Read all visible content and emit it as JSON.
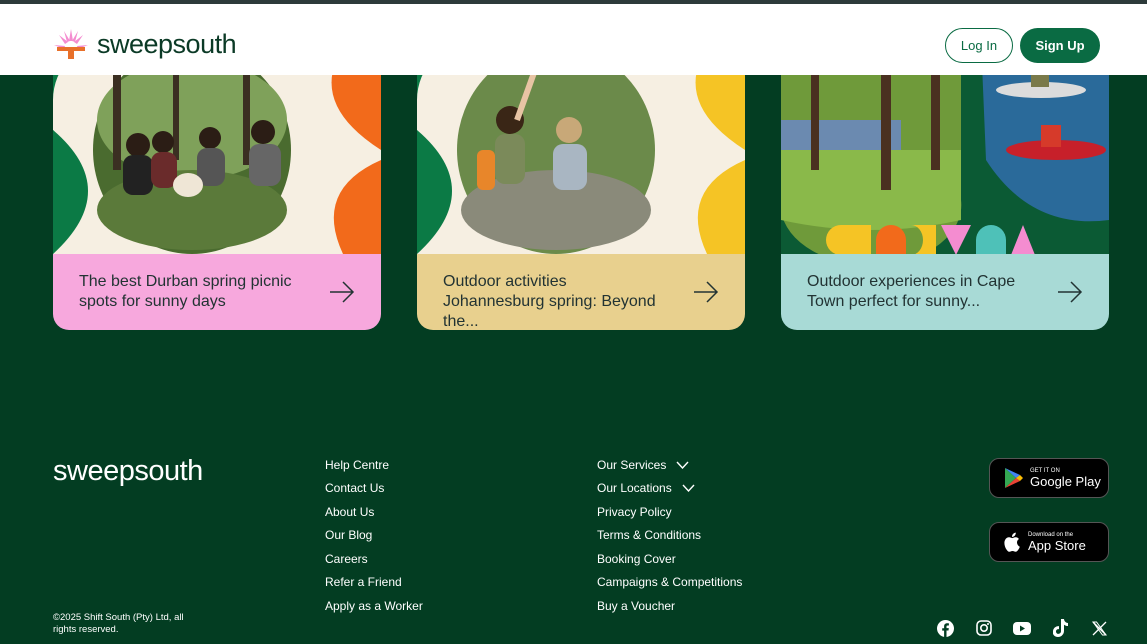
{
  "header": {
    "brand": "sweepsouth",
    "login_label": "Log In",
    "signup_label": "Sign Up"
  },
  "cards": [
    {
      "caption": "The best Durban spring picnic spots for sunny days",
      "bg": "#f7a8dd"
    },
    {
      "caption": "Outdoor activities Johannesburg spring: Beyond the...",
      "bg": "#e8d08e"
    },
    {
      "caption": "Outdoor experiences in Cape Town perfect for sunny...",
      "bg": "#a8dad6"
    }
  ],
  "footer": {
    "brand": "sweepsouth",
    "copyright": "©2025 Shift South (Pty) Ltd, all rights reserved.",
    "links_col1": [
      "Help Centre",
      "Contact Us",
      "About Us",
      "Our Blog",
      "Careers",
      "Refer a Friend",
      "Apply as a Worker"
    ],
    "links_col2": [
      "Our Services",
      "Our Locations",
      "Privacy Policy",
      "Terms & Conditions",
      "Booking Cover",
      "Campaigns & Competitions",
      "Buy a Voucher"
    ],
    "google_play": {
      "small": "GET IT ON",
      "big": "Google Play"
    },
    "app_store": {
      "small": "Download on the",
      "big": "App Store"
    },
    "social_icons": [
      "facebook-icon",
      "instagram-icon",
      "youtube-icon",
      "tiktok-icon",
      "x-icon"
    ]
  },
  "colors": {
    "background": "#033d22",
    "brand_green": "#0a6b43",
    "header_bg": "#ffffff"
  }
}
